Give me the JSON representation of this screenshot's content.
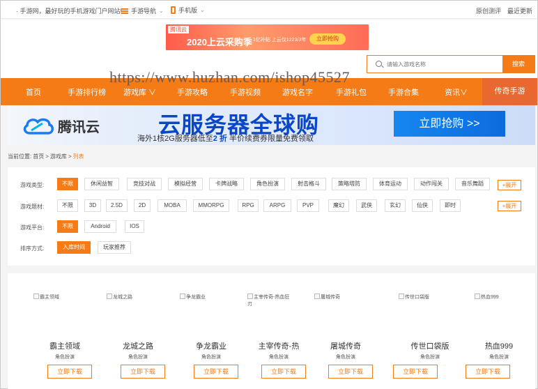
{
  "topbar": {
    "slogan": "·  手游网，最好玩的手机游戏门户网站!",
    "nav_label": "手游导航",
    "mobile_label": "手机版",
    "right_1": "原创测评",
    "right_2": "最近更新"
  },
  "ad_top": {
    "tag": "腾讯云",
    "title": "2020上云采购季",
    "sub": "1亿补贴 上云仅1223/3年",
    "button": "立即抢购"
  },
  "search": {
    "placeholder": "请输入游戏名称",
    "button": "搜索"
  },
  "mainnav": {
    "items": [
      "首页",
      "手游排行榜",
      "游戏库 ∨",
      "手游攻略",
      "手游视频",
      "游戏名字",
      "手游礼包",
      "手游合集",
      "资讯∨"
    ],
    "highlight": "传奇手游"
  },
  "watermark": "https://www.huzhan.com/ishop45527",
  "banner": {
    "brand": "腾讯云",
    "headline": "云服务器全球购",
    "sub_pre": "海外1核2G服务器低至",
    "sub_em": "2 折",
    "sub_post": " 半价续费券限量免费领取",
    "cta": "立即抢购 >>"
  },
  "breadcrumb": {
    "prefix": "当前位置:",
    "home": "首页",
    "sep": ">",
    "lib": "游戏库",
    "current": "列表"
  },
  "filters": {
    "type": {
      "label": "游戏类型:",
      "options": [
        "不限",
        "休闲益智",
        "竞技对战",
        "模拟经营",
        "卡牌战略",
        "角色扮演",
        "射击格斗",
        "策略塔防",
        "体育运动",
        "动作闯关",
        "音乐舞蹈"
      ]
    },
    "theme": {
      "label": "游戏题材:",
      "options": [
        "不限",
        "3D",
        "2.5D",
        "2D",
        "MOBA",
        "MMORPG",
        "RPG",
        "ARPG",
        "PVP",
        "魔幻",
        "武侠",
        "玄幻",
        "仙侠",
        "即时"
      ]
    },
    "platform": {
      "label": "游戏平台:",
      "options": [
        "不限",
        "Android",
        "IOS"
      ]
    },
    "sort": {
      "label": "排序方式:",
      "options": [
        "入库时间",
        "玩家推荐"
      ]
    },
    "expand": "+展开"
  },
  "games": [
    {
      "alt": "霸主领域",
      "name": "霸主领域",
      "cat": "角色扮演",
      "btn": "立即下载"
    },
    {
      "alt": "龙城之路",
      "name": "龙城之路",
      "cat": "角色扮演",
      "btn": "立即下载"
    },
    {
      "alt": "争龙霸业",
      "name": "争龙霸业",
      "cat": "角色扮演",
      "btn": "立即下载"
    },
    {
      "alt": "主宰传奇-热血狂刃",
      "name": "主宰传奇-热",
      "cat": "角色扮演",
      "btn": "立即下载"
    },
    {
      "alt": "屠城传奇",
      "name": "屠城传奇",
      "cat": "角色扮演",
      "btn": "立即下载"
    },
    {
      "alt": "传世口袋版",
      "name": "传世口袋版",
      "cat": "角色扮演",
      "btn": "立即下载"
    },
    {
      "alt": "热血999",
      "name": "热血999",
      "cat": "角色扮演",
      "btn": "立即下载"
    }
  ],
  "colors": {
    "accent": "#f57b17",
    "highlight_tab": "#e8682f",
    "banner_blue": "#0a47c8"
  }
}
